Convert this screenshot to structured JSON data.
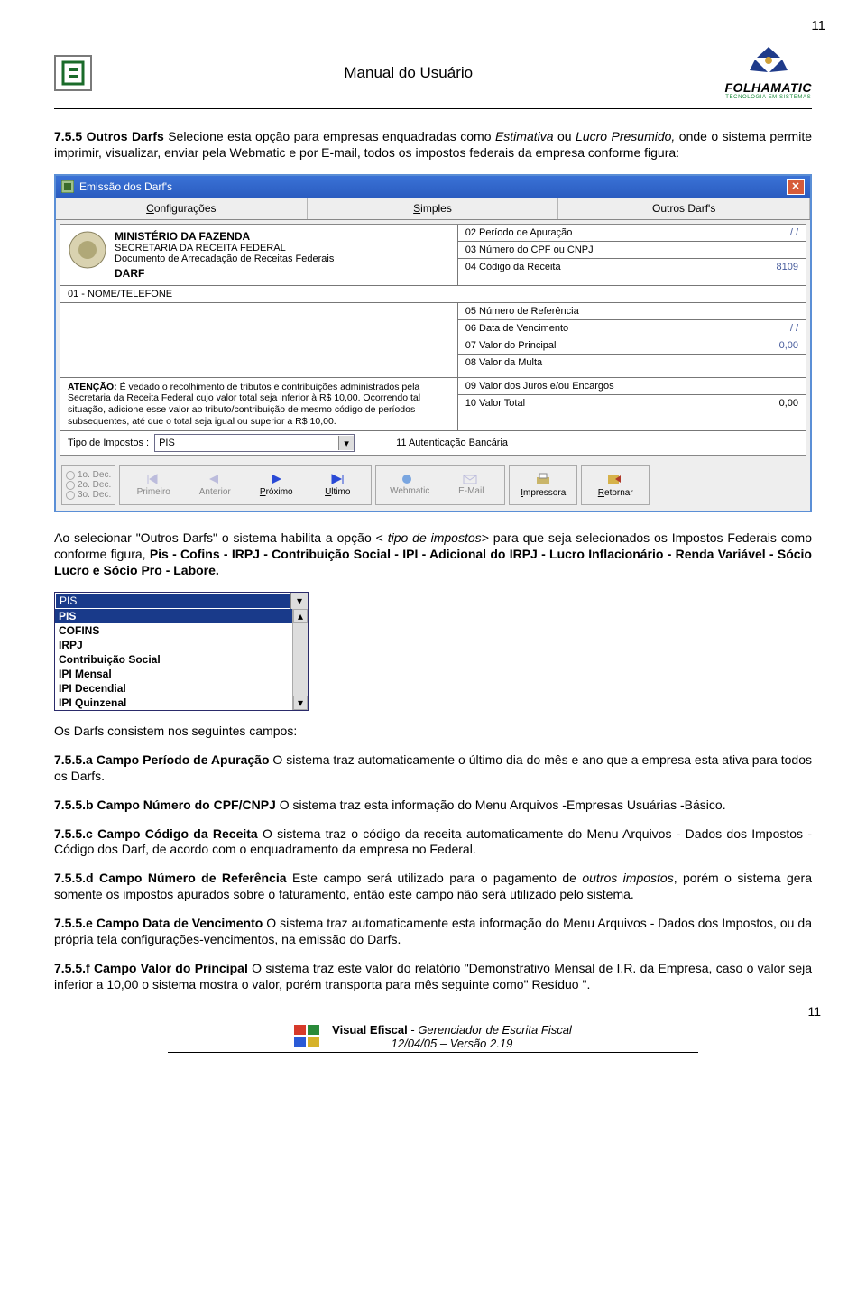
{
  "page": {
    "number_top": "11",
    "number_bottom": "11",
    "header_title": "Manual do Usuário"
  },
  "brand": {
    "wordmark": "FOLHAMATIC",
    "tagline": "TECNOLOGIA EM SISTEMAS"
  },
  "section": {
    "num": "7.5.5 Outros Darfs",
    "intro": " Selecione esta opção para empresas enquadradas como ",
    "intro_em1": "Estimativa",
    "intro_mid": " ou ",
    "intro_em2": "Lucro Presumido,",
    "intro_tail": " onde o sistema permite imprimir, visualizar, enviar pela Webmatic e por E-mail, todos os impostos federais da empresa conforme figura:"
  },
  "darfwin": {
    "title": "Emissão dos Darf's",
    "tabs": {
      "config": "Configurações",
      "simples": "Simples",
      "outros": "Outros Darf's"
    },
    "ministerio": {
      "l1": "MINISTÉRIO DA FAZENDA",
      "l2": "SECRETARIA DA RECEITA FEDERAL",
      "l3": "Documento de Arrecadação de Receitas Federais",
      "l4": "DARF"
    },
    "fields": {
      "f02": "02 Período de Apuração",
      "v02": "/  /",
      "f03": "03 Número do CPF ou CNPJ",
      "v03": "",
      "f04": "04 Código da Receita",
      "v04": "8109",
      "f01": "01 - NOME/TELEFONE",
      "f05": "05 Número de Referência",
      "v05": "",
      "f06": "06 Data de Vencimento",
      "v06": "/  /",
      "f07": "07 Valor do Principal",
      "v07": "0,00",
      "f08": "08 Valor da Multa",
      "v08": "",
      "f09": "09 Valor dos Juros e/ou Encargos",
      "v09": "",
      "f10": "10 Valor Total",
      "v10": "0,00",
      "f11": "11 Autenticação Bancária"
    },
    "atencao_label": "ATENÇÃO:",
    "atencao_text": "É vedado o recolhimento de tributos e contribuições administrados pela Secretaria da Receita Federal cujo valor total seja inferior à R$ 10,00. Ocorrendo tal situação, adicione esse valor ao tributo/contribuição de mesmo código de períodos subsequentes, até que o total seja igual ou superior a R$ 10,00.",
    "tipo_label": "Tipo de Impostos :",
    "tipo_value": "PIS",
    "radios": {
      "r1": "1o. Dec.",
      "r2": "2o. Dec.",
      "r3": "3o. Dec."
    },
    "buttons": {
      "primeiro": "Primeiro",
      "anterior": "Anterior",
      "proximo": "Próximo",
      "ultimo": "Ultimo",
      "webmatic": "Webmatic",
      "email": "E-Mail",
      "impressora": "Impressora",
      "retornar": "Retornar"
    }
  },
  "after_darf": {
    "p1a": "Ao selecionar \"Outros Darfs\" o sistema habilita a opção < ",
    "p1em": "tipo de impostos>",
    "p1b": " para que seja selecionados os Impostos Federais como conforme figura, ",
    "p1bold": "Pis - Cofins - IRPJ - Contribuição Social - IPI - Adicional do IRPJ - Lucro Inflacionário - Renda Variável - Sócio Lucro e Sócio Pro - Labore."
  },
  "combo": {
    "selected": "PIS",
    "options": [
      "PIS",
      "COFINS",
      "IRPJ",
      "Contribuição Social",
      "IPI Mensal",
      "IPI Decendial",
      "IPI Quinzenal"
    ]
  },
  "campos_intro": "Os Darfs consistem nos seguintes campos:",
  "campos": {
    "a_num": "7.5.5.a Campo Período de Apuração",
    "a_txt": " O sistema traz automaticamente o último dia do mês e ano que a empresa esta ativa para todos os Darfs.",
    "b_num": "7.5.5.b Campo Número do CPF/CNPJ",
    "b_txt": " O sistema traz esta informação do Menu Arquivos -Empresas Usuárias -Básico.",
    "c_num": "7.5.5.c Campo Código da Receita",
    "c_txt": " O sistema traz o código da receita automaticamente do Menu Arquivos - Dados dos Impostos -Código dos Darf, de acordo com o enquadramento da empresa no Federal.",
    "d_num": "7.5.5.d Campo Número de Referência",
    "d_txt1": " Este campo será utilizado para o pagamento de ",
    "d_em": "outros impostos",
    "d_txt2": ", porém o sistema gera somente os impostos apurados sobre o faturamento, então este campo não será utilizado pelo sistema.",
    "e_num": "7.5.5.e Campo Data de Vencimento",
    "e_txt": " O sistema traz automaticamente esta informação do Menu Arquivos - Dados dos Impostos, ou da própria tela configurações-vencimentos, na emissão do Darfs.",
    "f_num": "7.5.5.f Campo Valor do Principal",
    "f_txt": " O sistema traz este valor do relatório \"Demonstrativo Mensal de I.R. da Empresa, caso o valor seja inferior a 10,00 o sistema mostra o valor, porém transporta para mês seguinte como\" Resíduo \"."
  },
  "footer": {
    "l1a": "Visual Efiscal",
    "l1b": " - ",
    "l1c": "Gerenciador de Escrita Fiscal",
    "l2": "12/04/05 – Versão 2.19"
  }
}
